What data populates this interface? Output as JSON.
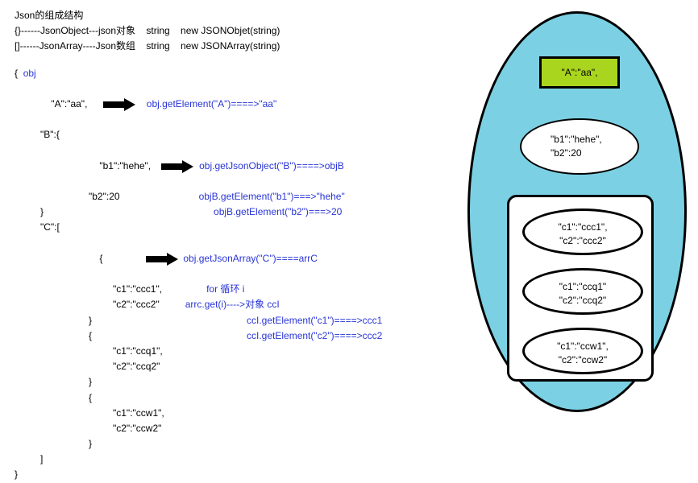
{
  "header": {
    "title": "Json的组成结构",
    "line1": "{}------JsonObject---json对象    string    new JSONObjet(string)",
    "line2": "[]------JsonArray----Json数组    string    new JSONArray(string)"
  },
  "code": {
    "objLabel": "obj",
    "open": "{",
    "a": "\"A\":\"aa\",",
    "b_open": "\"B\":{",
    "b1": "\"b1\":\"hehe\",",
    "b2": "\"b2\":20",
    "b_close": "}",
    "c_open": "\"C\":[",
    "item_open": "{",
    "c1a": "\"c1\":\"ccc1\",",
    "c2a": "\"c2\":\"ccc2\"",
    "c1b": "\"c1\":\"ccq1\",",
    "c2b": "\"c2\":\"ccq2\"",
    "c1c": "\"c1\":\"ccw1\",",
    "c2c": "\"c2\":\"ccw2\"",
    "item_close": "}",
    "c_close": "]",
    "close": "}"
  },
  "annot": {
    "a": "obj.getElement(\"A\")====>\"aa\"",
    "b1": "obj.getJsonObject(\"B\")====>objB",
    "b2": "objB.getElement(\"b1\")===>\"hehe\"",
    "b3": "objB.getElement(\"b2\")===>20",
    "c1": "obj.getJsonArray(\"C\")====arrC",
    "c2": "for    循环   i",
    "c3": "arrc.get(i)---->对象   ccI",
    "c4": "ccI.getElement(\"c1\")====>ccc1",
    "c5": "ccI.getElement(\"c2\")====>ccc2"
  },
  "diagram": {
    "aBox": "\"A\":\"aa\",",
    "bEllipse_l1": "\"b1\":\"hehe\",",
    "bEllipse_l2": "\"b2\":20",
    "e1_l1": "\"c1\":\"ccc1\",",
    "e1_l2": "\"c2\":\"ccc2\"",
    "e2_l1": "\"c1\":\"ccq1\"",
    "e2_l2": "\"c2\":\"ccq2\"",
    "e3_l1": "\"c1\":\"ccw1\",",
    "e3_l2": "\"c2\":\"ccw2\""
  },
  "chart_data": {
    "type": "diagram",
    "description": "JSON structure tutorial: code on left with method annotations, visual container diagram on right",
    "json_sample": {
      "A": "aa",
      "B": {
        "b1": "hehe",
        "b2": 20
      },
      "C": [
        {
          "c1": "ccc1",
          "c2": "ccc2"
        },
        {
          "c1": "ccq1",
          "c2": "ccq2"
        },
        {
          "c1": "ccw1",
          "c2": "ccw2"
        }
      ]
    },
    "method_mappings": [
      {
        "call": "obj.getElement(\"A\")",
        "result": "\"aa\""
      },
      {
        "call": "obj.getJsonObject(\"B\")",
        "result": "objB"
      },
      {
        "call": "objB.getElement(\"b1\")",
        "result": "\"hehe\""
      },
      {
        "call": "objB.getElement(\"b2\")",
        "result": 20
      },
      {
        "call": "obj.getJsonArray(\"C\")",
        "result": "arrC"
      },
      {
        "call": "arrc.get(i)",
        "result": "ccI"
      },
      {
        "call": "ccI.getElement(\"c1\")",
        "result": "ccc1"
      },
      {
        "call": "ccI.getElement(\"c2\")",
        "result": "ccc2"
      }
    ],
    "right_diagram": {
      "outer_ellipse_color": "#7cd0e3",
      "top_rect": {
        "fill": "#aad51e",
        "text": "\"A\":\"aa\","
      },
      "middle_ellipse": {
        "fill": "#ffffff",
        "lines": [
          "\"b1\":\"hehe\",",
          "\"b2\":20"
        ]
      },
      "bottom_roundrect": {
        "fill": "#ffffff",
        "items": [
          [
            "\"c1\":\"ccc1\",",
            "\"c2\":\"ccc2\""
          ],
          [
            "\"c1\":\"ccq1\"",
            "\"c2\":\"ccq2\""
          ],
          [
            "\"c1\":\"ccw1\",",
            "\"c2\":\"ccw2\""
          ]
        ]
      }
    }
  }
}
